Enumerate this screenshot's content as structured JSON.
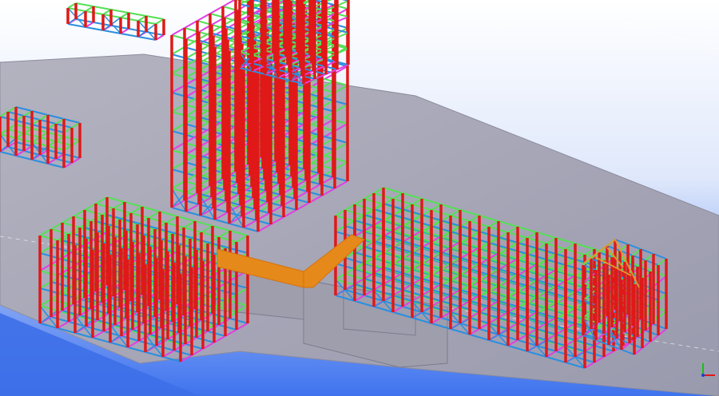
{
  "viewport": {
    "background_top": "#ffffff",
    "background_bottom": "#4a7df0",
    "slab_color": "#a9a9b6",
    "slab_edge_color": "#8c8c9c"
  },
  "member_colors": {
    "column": "#e01818",
    "beam": "#55e055",
    "brace": "#2a8fe0",
    "secondary": "#e040e0",
    "stair": "#e07a10",
    "rafter": "#4aa8f0"
  },
  "icons": {
    "axis_gizmo": "xyz-axis-icon"
  }
}
